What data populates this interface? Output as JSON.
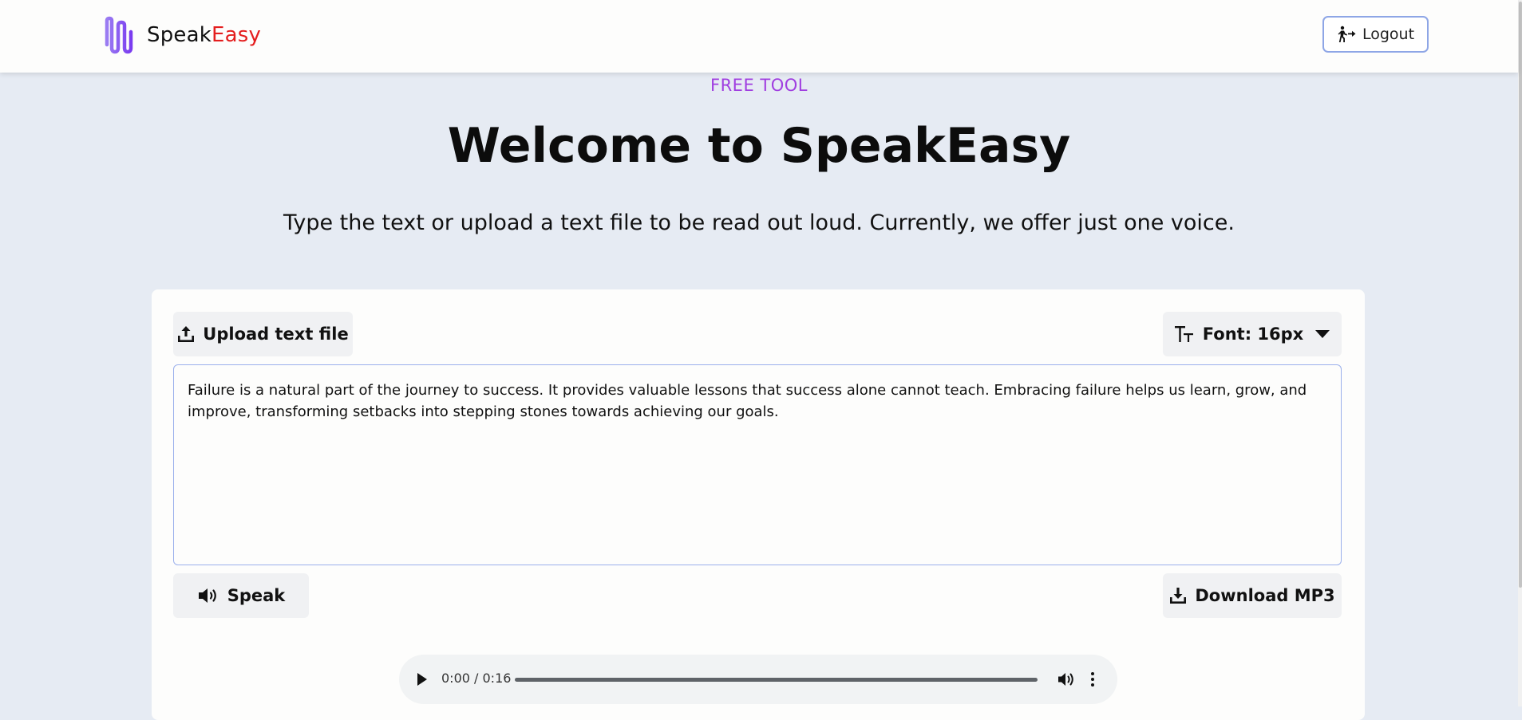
{
  "app": {
    "logo_part1": "Speak",
    "logo_part2": "Easy",
    "logout_label": "Logout"
  },
  "hero": {
    "eyebrow": "FREE TOOL",
    "title": "Welcome to SpeakEasy",
    "subtitle": "Type the text or upload a text file to be read out loud. Currently, we offer just one voice."
  },
  "editor": {
    "upload_label": "Upload text file",
    "font_label": "Font: 16px",
    "text": "Failure is a natural part of the journey to success. It provides valuable lessons that success alone cannot teach. Embracing failure helps us learn, grow, and improve, transforming setbacks into stepping stones towards achieving our goals.",
    "speak_label": "Speak",
    "download_label": "Download MP3"
  },
  "audio_player": {
    "time": "0:00 / 0:16"
  },
  "icons": {
    "logo": "sound-wave-logo-icon",
    "logout": "walk-out-icon",
    "upload": "upload-icon",
    "font": "text-size-icon",
    "caret": "caret-down-icon",
    "speak": "speaker-icon",
    "download": "download-icon",
    "play": "play-icon",
    "volume": "volume-icon",
    "more": "more-vertical-icon"
  },
  "colors": {
    "brand_purple": "#8b5cf6",
    "brand_red": "#e41e1e",
    "eyebrow": "#a03ee0",
    "accent_border": "#8ea6e6",
    "page_bg": "#e6ebf3"
  }
}
